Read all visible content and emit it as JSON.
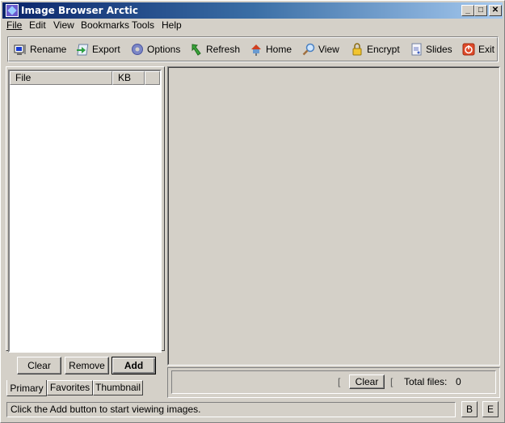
{
  "window": {
    "title": "Image Browser Arctic",
    "controls": {
      "minimize": "_",
      "maximize": "□",
      "close": "✕"
    }
  },
  "menu": [
    {
      "label": "File",
      "accel": "F"
    },
    {
      "label": "Edit",
      "accel": "E"
    },
    {
      "label": "View",
      "accel": "V"
    },
    {
      "label": "Bookmarks",
      "accel": "B"
    },
    {
      "label": "Tools",
      "accel": "T"
    },
    {
      "label": "Help",
      "accel": "H"
    }
  ],
  "toolbar": [
    {
      "label": "Rename",
      "icon": "monitor-icon"
    },
    {
      "label": "Export",
      "icon": "export-icon"
    },
    {
      "label": "Options",
      "icon": "gear-icon"
    },
    {
      "label": "Refresh",
      "icon": "refresh-icon"
    },
    {
      "label": "Home",
      "icon": "home-icon"
    },
    {
      "label": "View",
      "icon": "magnifier-icon"
    },
    {
      "label": "Encrypt",
      "icon": "lock-icon"
    },
    {
      "label": "Slides",
      "icon": "slides-icon"
    },
    {
      "label": "Exit",
      "icon": "power-icon"
    }
  ],
  "file_list": {
    "columns": [
      "File",
      "KB",
      ""
    ],
    "rows": []
  },
  "list_buttons": {
    "clear": "Clear",
    "remove": "Remove",
    "add": "Add"
  },
  "tabs": [
    {
      "label": "Primary",
      "active": true
    },
    {
      "label": "Favorites",
      "active": false
    },
    {
      "label": "Thumbnail",
      "active": false
    }
  ],
  "bottom_bar": {
    "clear_label": "Clear",
    "bracket_left": "[",
    "bracket_right": "[",
    "total_label": "Total files:",
    "total_value": "0"
  },
  "status": {
    "message": "Click the Add button to start viewing images.",
    "btn_b": "B",
    "btn_e": "E"
  }
}
